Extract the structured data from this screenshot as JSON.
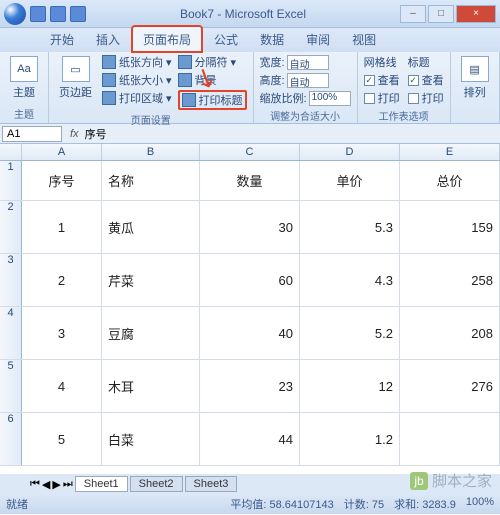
{
  "title": "Book7 - Microsoft Excel",
  "tabs": [
    "开始",
    "插入",
    "页面布局",
    "公式",
    "数据",
    "审阅",
    "视图"
  ],
  "active_tab": 2,
  "ribbon": {
    "themes": {
      "btn": "主题",
      "label": "主题"
    },
    "page_setup": {
      "margins": "页边距",
      "orientation": "纸张方向",
      "size": "纸张大小",
      "print_area": "打印区域",
      "breaks": "分隔符",
      "background": "背景",
      "print_titles": "打印标题",
      "label": "页面设置"
    },
    "scale": {
      "width": "宽度:",
      "height": "高度:",
      "scale": "缩放比例:",
      "auto": "自动",
      "pct": "100%",
      "label": "调整为合适大小"
    },
    "sheet_opts": {
      "gridlines": "网格线",
      "headings": "标题",
      "view": "查看",
      "print": "打印",
      "label": "工作表选项"
    },
    "arrange": {
      "btn": "排列"
    }
  },
  "namebox": {
    "cell": "A1",
    "formula": "序号"
  },
  "columns": [
    "A",
    "B",
    "C",
    "D",
    "E"
  ],
  "header_row": [
    "序号",
    "名称",
    "数量",
    "单价",
    "总价"
  ],
  "data": [
    {
      "n": "1",
      "name": "黄瓜",
      "qty": "30",
      "price": "5.3",
      "total": "159"
    },
    {
      "n": "2",
      "name": "芹菜",
      "qty": "60",
      "price": "4.3",
      "total": "258"
    },
    {
      "n": "3",
      "name": "豆腐",
      "qty": "40",
      "price": "5.2",
      "total": "208"
    },
    {
      "n": "4",
      "name": "木耳",
      "qty": "23",
      "price": "12",
      "total": "276"
    },
    {
      "n": "5",
      "name": "白菜",
      "qty": "44",
      "price": "1.2",
      "total": ""
    }
  ],
  "sheets": [
    "Sheet1",
    "Sheet2",
    "Sheet3"
  ],
  "status": {
    "ready": "就绪",
    "avg": "平均值: 58.64107143",
    "count": "计数: 75",
    "sum": "求和: 3283.9",
    "zoom": "100%"
  },
  "watermark": "脚本之家",
  "winbtns": {
    "min": "–",
    "max": "□",
    "close": "×"
  }
}
